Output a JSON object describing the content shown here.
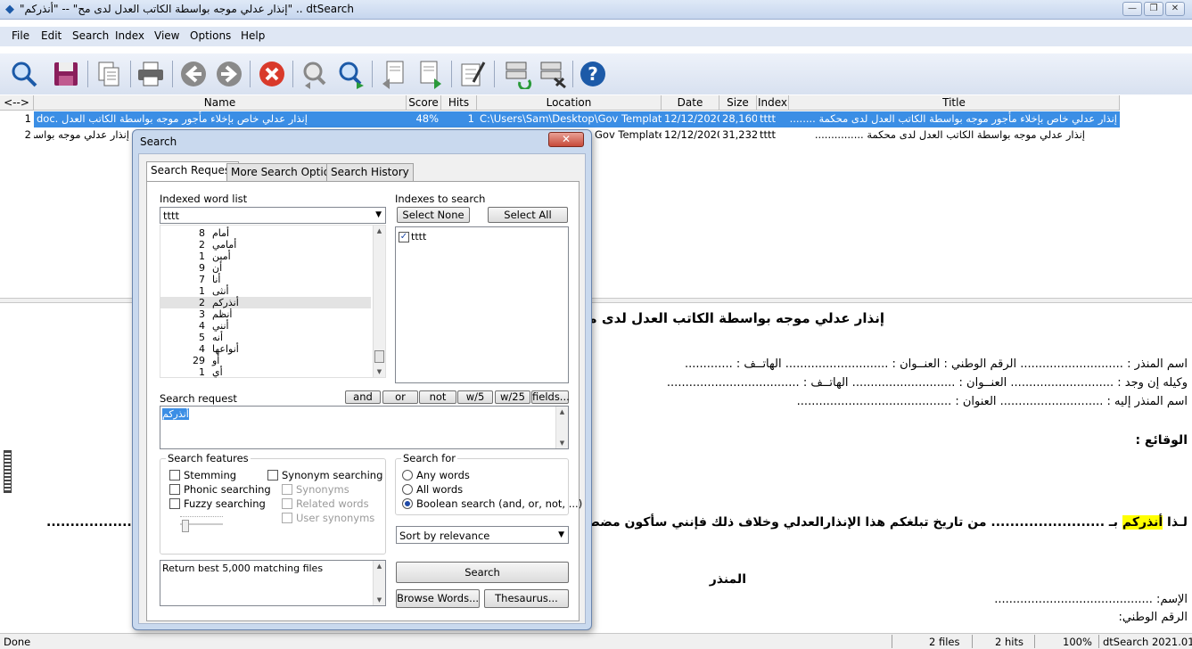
{
  "window": {
    "title": "\"إنذار عدلي موجه بواسطة الكاتب العدل لدى مح\" -- \"أنذركم\" .. dtSearch",
    "controls": [
      "—",
      "❐",
      "✕"
    ]
  },
  "menu": [
    "File",
    "Edit",
    "Search",
    "Index",
    "View",
    "Options",
    "Help"
  ],
  "columns": [
    "<-->",
    "Name",
    "Score",
    "Hits",
    "Location",
    "Date",
    "Size",
    "Index",
    "Title"
  ],
  "results": [
    {
      "num": "1",
      "name": "إنذار عدلي خاص بإخلاء مأجور موجه بواسطة الكاتب العدل .doc",
      "score": "48%",
      "hits": "1",
      "location": "C:\\Users\\Sam\\Desktop\\Gov Template",
      "date": "12/12/2020",
      "size": "28,160",
      "index": "tttt",
      "title": "إنذار عدلي خاص بإخلاء مأجور موجه بواسطة الكاتب العدل لدى محكمة ..............."
    },
    {
      "num": "2",
      "name": "إنذار عدلي موجه بواسطة الكاتب العدل لدى محكمة",
      "score": "",
      "hits": "",
      "location": "Gov Template",
      "date": "12/12/2020",
      "size": "31,232",
      "index": "tttt",
      "title": "إنذار عدلي موجه بواسطة الكاتب العدل لدى محكمة ..............."
    }
  ],
  "preview": {
    "heading": "إنذار عدلي موجه بواسطة الكاتب العدل لدى محـ",
    "line1": "اسم المنذر : ............................ الرقم الوطني : العنــوان : ............................ الهاتــف : .............",
    "line2": "وكيله إن وجد : ............................ العنــوان : ............................ الهاتــف : ....................................",
    "line3": "اسم المنذر إليه : ............................ العنوان : ..........................................",
    "facts": "الوقائع :",
    "lead": "لـذا ",
    "highlight": "أنذركم",
    "rest": " بـ ........................ من تاريخ تبلغكم هذا الإنذارالعدلي وخلاف ذلك فإنني سأكون مضطراً لـ",
    "dots_left": "......................................",
    "sender": "المنذر",
    "name_field": "الإسم: ...........................................",
    "national_field": "الرقم الوطني:"
  },
  "status": {
    "left": "Done",
    "files": "2 files",
    "hits": "2 hits",
    "zoom": "100%",
    "version": "dtSearch 2021.01.87"
  },
  "dialog": {
    "title": "Search",
    "close": "✕",
    "tabs": [
      "Search Request",
      "More Search Options",
      "Search History"
    ],
    "indexed_word_list_label": "Indexed word list",
    "index_select": "tttt",
    "words": [
      {
        "count": "8",
        "word": "أمام"
      },
      {
        "count": "2",
        "word": "أمامي"
      },
      {
        "count": "1",
        "word": "أمين"
      },
      {
        "count": "9",
        "word": "أن"
      },
      {
        "count": "7",
        "word": "أنا"
      },
      {
        "count": "1",
        "word": "أنثى"
      },
      {
        "count": "2",
        "word": "أنذركم"
      },
      {
        "count": "3",
        "word": "أنظم"
      },
      {
        "count": "4",
        "word": "أنني"
      },
      {
        "count": "5",
        "word": "أنه"
      },
      {
        "count": "4",
        "word": "أنواعها"
      },
      {
        "count": "29",
        "word": "أو"
      },
      {
        "count": "1",
        "word": "أي"
      }
    ],
    "selected_word_index": 6,
    "indexes_label": "Indexes to search",
    "select_none": "Select None",
    "select_all": "Select All",
    "index_item": "tttt",
    "search_request_label": "Search request",
    "ops": [
      "and",
      "or",
      "not",
      "w/5",
      "w/25",
      "fields..."
    ],
    "request_text": "أنذركم",
    "features_label": "Search features",
    "stemming": "Stemming",
    "phonic": "Phonic searching",
    "fuzzy": "Fuzzy searching",
    "synonym": "Synonym searching",
    "synonyms": "Synonyms",
    "related": "Related words",
    "user_synonyms": "User synonyms",
    "search_for_label": "Search for",
    "any_words": "Any words",
    "all_words": "All words",
    "boolean": "Boolean search (and, or, not, ...)",
    "sort": "Sort by relevance",
    "return_best": "Return best 5,000 matching files",
    "search_btn": "Search",
    "browse_btn": "Browse Words...",
    "thesaurus_btn": "Thesaurus..."
  }
}
